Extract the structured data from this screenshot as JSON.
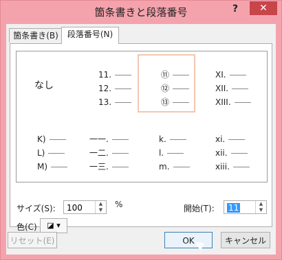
{
  "window": {
    "title": "箇条書きと段落番号",
    "help": "?",
    "close": "✕"
  },
  "tabs": [
    {
      "label": "箇条書き(B)",
      "active": false
    },
    {
      "label": "段落番号(N)",
      "active": true
    }
  ],
  "gallery": {
    "none_label": "なし",
    "columns": [
      [
        "11.",
        "12.",
        "13."
      ],
      [
        "⑪",
        "⑫",
        "⑬"
      ],
      [
        "XI.",
        "XII.",
        "XIII."
      ],
      [
        "K)",
        "L)",
        "M)"
      ],
      [
        "一一.",
        "一二.",
        "一三."
      ],
      [
        "k.",
        "l.",
        "m."
      ],
      [
        "xi.",
        "xii.",
        "xiii."
      ]
    ]
  },
  "size": {
    "label": "サイズ(S):",
    "value": "100",
    "unit": "%"
  },
  "start": {
    "label": "開始(T):",
    "value": "11"
  },
  "color": {
    "label": "色(C)"
  },
  "buttons": {
    "reset": "リセット(E)",
    "ok": "OK",
    "cancel": "キャンセル"
  }
}
